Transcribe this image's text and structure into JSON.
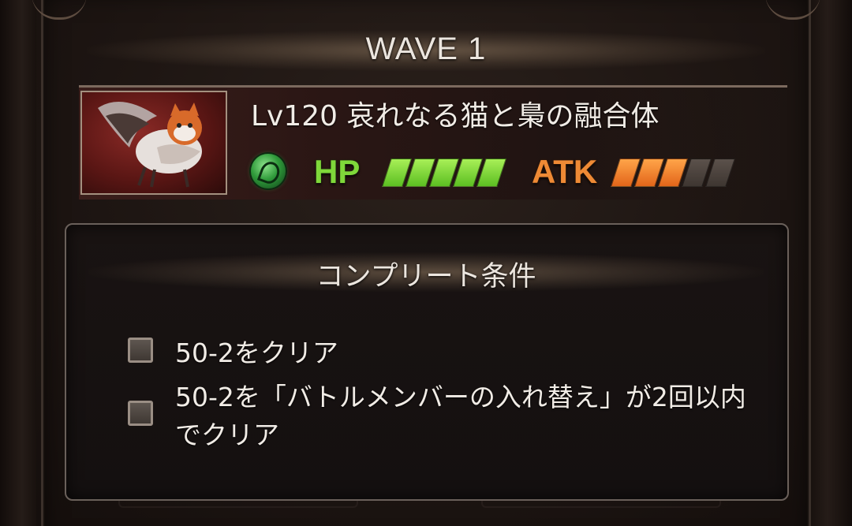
{
  "wave": {
    "title": "WAVE 1"
  },
  "enemy": {
    "name": "Lv120 哀れなる猫と梟の融合体",
    "element": "wind-element-icon",
    "hp_label": "HP",
    "hp_gauge": {
      "filled": 5,
      "total": 5
    },
    "atk_label": "ATK",
    "atk_gauge": {
      "filled": 3,
      "total": 5
    },
    "colors": {
      "hp": "#7fd83a",
      "atk": "#ee8a35",
      "element": "#2f9a3a"
    }
  },
  "conditions": {
    "title": "コンプリート条件",
    "items": [
      {
        "text": "50-2をクリア",
        "checked": false
      },
      {
        "text_line1": "50-2を「バトルメンバーの入れ替え」が2回以内",
        "text_line2": "でクリア",
        "checked": false
      }
    ]
  }
}
